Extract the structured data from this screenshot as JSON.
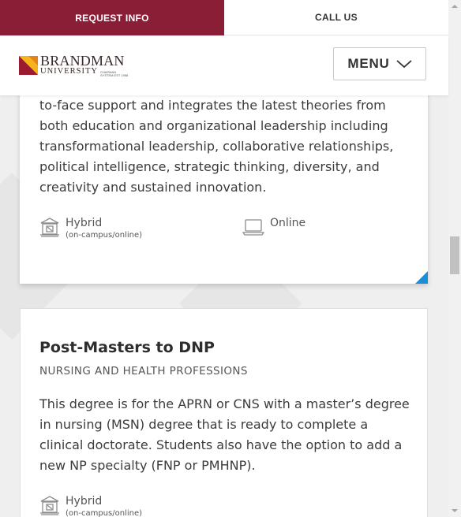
{
  "topbar": {
    "request_label": "REQUEST INFO",
    "call_label": "CALL US"
  },
  "header": {
    "logo_name": "BRANDMAN",
    "logo_university": "UNIVERSITY",
    "logo_tagline": "CHAPMAN SYSTEM EST 1958",
    "menu_label": "MENU"
  },
  "programs": [
    {
      "description": "to-face support and integrates the latest theories from both education and organizational leadership including transformational leadership, collaborative relationships, political intelligence, strategic thinking, diversity, and creativity and sustained innovation.",
      "modes": [
        {
          "label": "Hybrid",
          "sub": "(on-campus/online)",
          "icon": "campus-building-icon"
        },
        {
          "label": "Online",
          "icon": "laptop-icon"
        }
      ]
    },
    {
      "title": "Post-Masters to DNP",
      "category": "NURSING AND HEALTH PROFESSIONS",
      "description": "This degree is for the APRN or CNS with a master’s degree in nursing (MSN) degree that is ready to complete a clinical doctorate. Students also have the option to add a new NP specialty (FNP or PMHNP).",
      "modes": [
        {
          "label": "Hybrid",
          "sub": "(on-campus/online)",
          "icon": "campus-building-icon"
        }
      ]
    }
  ],
  "colors": {
    "brand": "#8a1e36",
    "accent": "#1a8fd6",
    "logo_gold": "#f4b41a",
    "logo_red": "#9b1b30"
  }
}
